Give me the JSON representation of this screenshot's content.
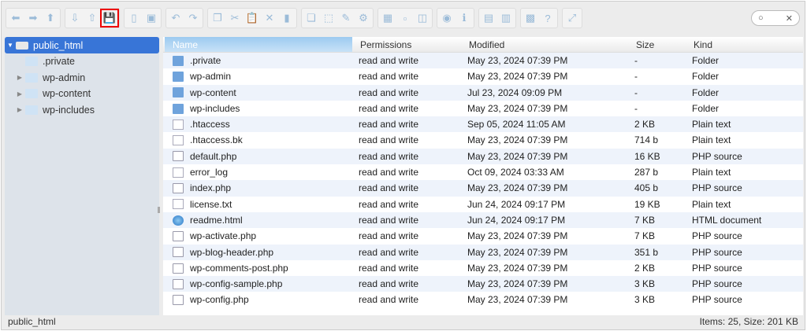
{
  "toolbar": {
    "groups": [
      [
        "back-icon",
        "forward-icon",
        "up-icon"
      ],
      [
        "download-icon",
        "upload-icon",
        "save-icon"
      ],
      [
        "open-icon",
        "save-as-icon"
      ],
      [
        "undo-icon",
        "redo-icon"
      ],
      [
        "copy-icon",
        "cut-icon",
        "paste-icon",
        "delete-icon",
        "rename-icon"
      ],
      [
        "duplicate-icon",
        "select-icon",
        "edit-icon",
        "extract-icon"
      ],
      [
        "icons-view-icon",
        "list-view-icon",
        "columns-icon"
      ],
      [
        "preview-icon",
        "info-icon"
      ],
      [
        "archive-icon",
        "unarchive-icon"
      ],
      [
        "sort-icon",
        "help-icon"
      ],
      [
        "fullscreen-icon"
      ]
    ],
    "search_clear": "✕"
  },
  "sidebar": {
    "root": "public_html",
    "items": [
      {
        "label": ".private",
        "expandable": false
      },
      {
        "label": "wp-admin",
        "expandable": true
      },
      {
        "label": "wp-content",
        "expandable": true
      },
      {
        "label": "wp-includes",
        "expandable": true
      }
    ]
  },
  "columns": {
    "name": "Name",
    "permissions": "Permissions",
    "modified": "Modified",
    "size": "Size",
    "kind": "Kind"
  },
  "files": [
    {
      "name": ".private",
      "perm": "read and write",
      "mod": "May 23, 2024 07:39 PM",
      "size": "-",
      "kind": "Folder",
      "icon": "folder"
    },
    {
      "name": "wp-admin",
      "perm": "read and write",
      "mod": "May 23, 2024 07:39 PM",
      "size": "-",
      "kind": "Folder",
      "icon": "folder"
    },
    {
      "name": "wp-content",
      "perm": "read and write",
      "mod": "Jul 23, 2024 09:09 PM",
      "size": "-",
      "kind": "Folder",
      "icon": "folder"
    },
    {
      "name": "wp-includes",
      "perm": "read and write",
      "mod": "May 23, 2024 07:39 PM",
      "size": "-",
      "kind": "Folder",
      "icon": "folder"
    },
    {
      "name": ".htaccess",
      "perm": "read and write",
      "mod": "Sep 05, 2024 11:05 AM",
      "size": "2 KB",
      "kind": "Plain text",
      "icon": "text"
    },
    {
      "name": ".htaccess.bk",
      "perm": "read and write",
      "mod": "May 23, 2024 07:39 PM",
      "size": "714 b",
      "kind": "Plain text",
      "icon": "text"
    },
    {
      "name": "default.php",
      "perm": "read and write",
      "mod": "May 23, 2024 07:39 PM",
      "size": "16 KB",
      "kind": "PHP source",
      "icon": "php"
    },
    {
      "name": "error_log",
      "perm": "read and write",
      "mod": "Oct 09, 2024 03:33 AM",
      "size": "287 b",
      "kind": "Plain text",
      "icon": "text"
    },
    {
      "name": "index.php",
      "perm": "read and write",
      "mod": "May 23, 2024 07:39 PM",
      "size": "405 b",
      "kind": "PHP source",
      "icon": "php"
    },
    {
      "name": "license.txt",
      "perm": "read and write",
      "mod": "Jun 24, 2024 09:17 PM",
      "size": "19 KB",
      "kind": "Plain text",
      "icon": "text"
    },
    {
      "name": "readme.html",
      "perm": "read and write",
      "mod": "Jun 24, 2024 09:17 PM",
      "size": "7 KB",
      "kind": "HTML document",
      "icon": "html"
    },
    {
      "name": "wp-activate.php",
      "perm": "read and write",
      "mod": "May 23, 2024 07:39 PM",
      "size": "7 KB",
      "kind": "PHP source",
      "icon": "php"
    },
    {
      "name": "wp-blog-header.php",
      "perm": "read and write",
      "mod": "May 23, 2024 07:39 PM",
      "size": "351 b",
      "kind": "PHP source",
      "icon": "php"
    },
    {
      "name": "wp-comments-post.php",
      "perm": "read and write",
      "mod": "May 23, 2024 07:39 PM",
      "size": "2 KB",
      "kind": "PHP source",
      "icon": "php"
    },
    {
      "name": "wp-config-sample.php",
      "perm": "read and write",
      "mod": "May 23, 2024 07:39 PM",
      "size": "3 KB",
      "kind": "PHP source",
      "icon": "php"
    },
    {
      "name": "wp-config.php",
      "perm": "read and write",
      "mod": "May 23, 2024 07:39 PM",
      "size": "3 KB",
      "kind": "PHP source",
      "icon": "php"
    }
  ],
  "status": {
    "path": "public_html",
    "summary": "Items: 25, Size: 201 KB"
  }
}
